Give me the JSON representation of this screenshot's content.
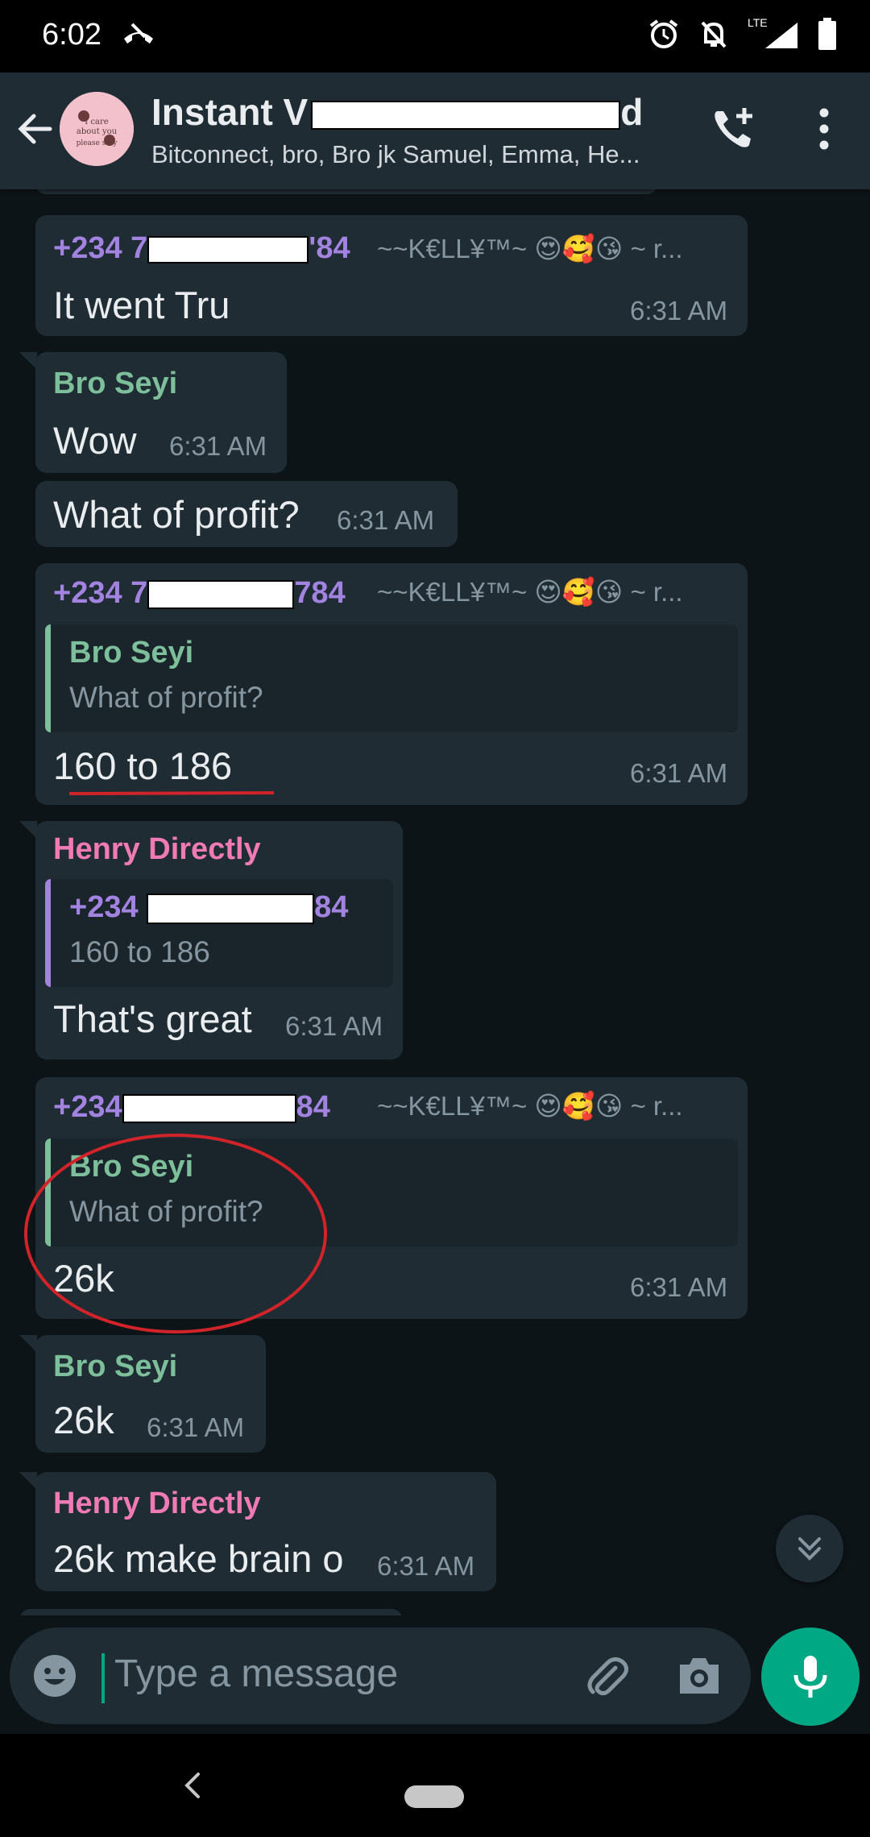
{
  "status_bar": {
    "time": "6:02",
    "network": "LTE"
  },
  "header": {
    "title": "Instant V",
    "title_tail": "d",
    "subtitle": "Bitconnect, bro, Bro jk Samuel, Emma, He..."
  },
  "messages": [
    {
      "sender": "+234 7",
      "sender_end": "'84",
      "extra": "~~K€LL¥™~ 😍🥰😘 ~ r...",
      "text": "It went Tru",
      "time": "6:31 AM"
    },
    {
      "sender": "Bro Seyi",
      "text": "Wow",
      "time": "6:31 AM"
    },
    {
      "text": "What of profit?",
      "time": "6:31 AM"
    },
    {
      "sender": "+234 7",
      "sender_end": "784",
      "extra": "~~K€LL¥™~ 😍🥰😘 ~ r...",
      "quote_sender": "Bro Seyi",
      "quote_text": "What of profit?",
      "text": "160 to 186",
      "time": "6:31 AM"
    },
    {
      "sender": "Henry Directly",
      "quote_sender": "+234",
      "quote_sender_end": "84",
      "quote_text": "160 to 186",
      "text": "That's great",
      "time": "6:31 AM"
    },
    {
      "sender": "+234",
      "sender_end": "84",
      "extra": "~~K€LL¥™~ 😍🥰😘 ~ r...",
      "quote_sender": "Bro Seyi",
      "quote_text": "What of profit?",
      "text": "26k",
      "time": "6:31 AM"
    },
    {
      "sender": "Bro Seyi",
      "text": "26k",
      "time": "6:31 AM"
    },
    {
      "sender": "Henry Directly",
      "text": "26k make brain o",
      "time": "6:31 AM"
    }
  ],
  "input": {
    "placeholder": "Type a message"
  },
  "colors": {
    "background": "#0d1418",
    "bubble": "#1f2c34",
    "accent": "#00a884",
    "annotation_red": "#d0242a"
  },
  "icons": [
    "back-arrow-icon",
    "add-call-icon",
    "more-vert-icon",
    "emoji-icon",
    "attach-icon",
    "camera-icon",
    "mic-icon",
    "scroll-down-icon",
    "alarm-icon",
    "notifications-off-icon",
    "signal-icon",
    "battery-icon",
    "call-end-icon"
  ]
}
